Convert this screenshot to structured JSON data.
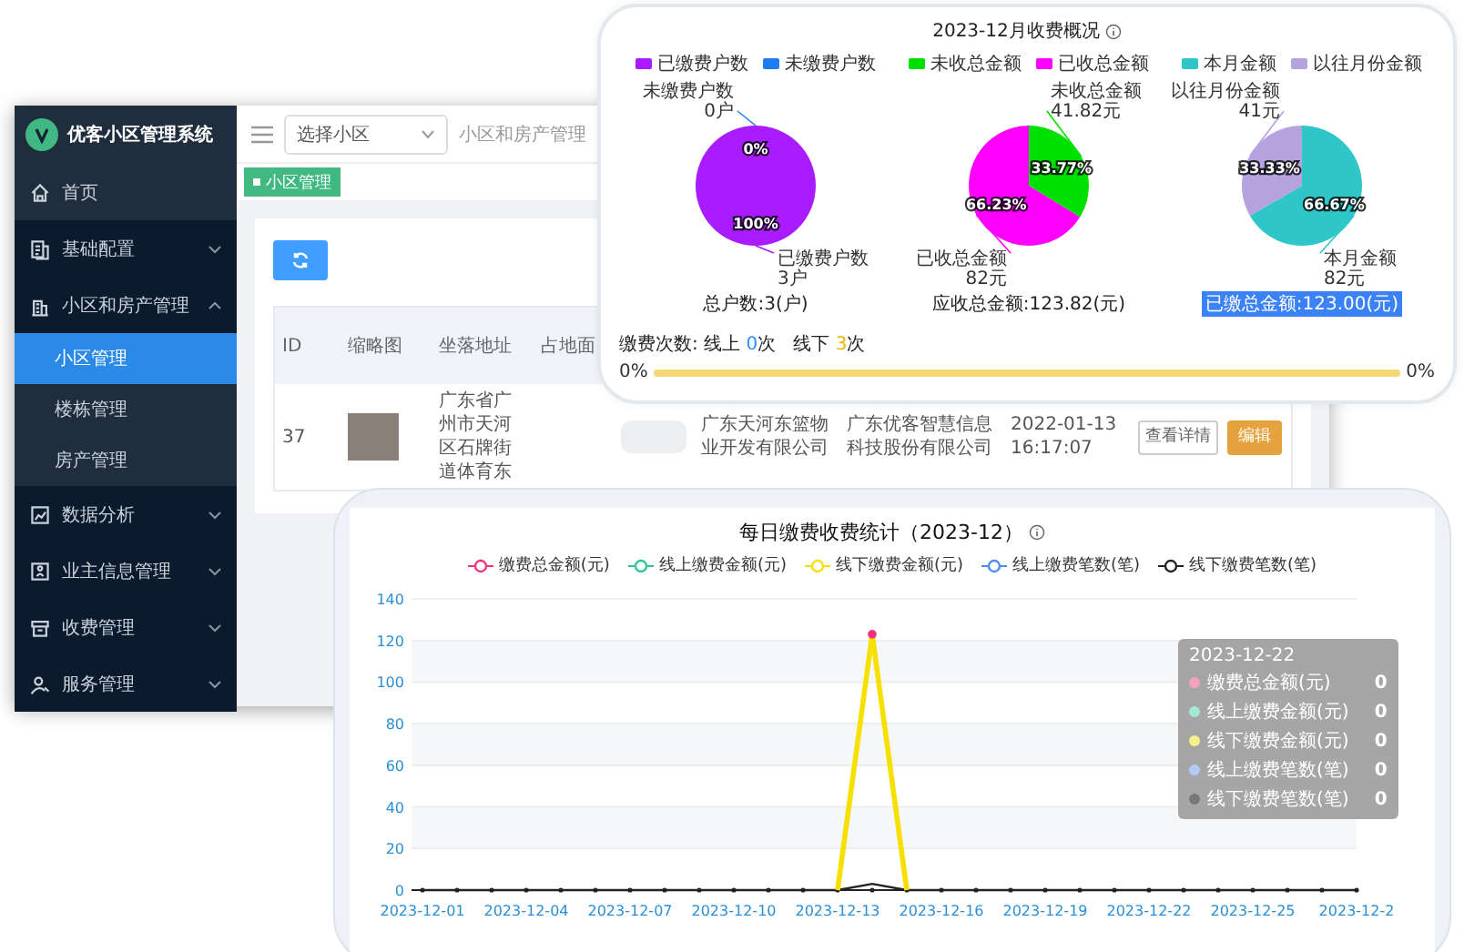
{
  "admin_window": {
    "logo_title": "优客小区管理系统",
    "sidebar": {
      "items": [
        {
          "label": "首页",
          "kind": "home",
          "highlighted": true
        },
        {
          "label": "基础配置",
          "kind": "document",
          "highlighted": false,
          "expanded": false
        },
        {
          "label": "小区和房产管理",
          "kind": "building",
          "highlighted": false,
          "expanded": true,
          "children": [
            {
              "label": "小区管理",
              "selected": true
            },
            {
              "label": "楼栋管理",
              "selected": false
            },
            {
              "label": "房产管理",
              "selected": false
            }
          ]
        },
        {
          "label": "数据分析",
          "kind": "chart",
          "highlighted": false,
          "expanded": false
        },
        {
          "label": "业主信息管理",
          "kind": "card",
          "highlighted": false,
          "expanded": false
        },
        {
          "label": "收费管理",
          "kind": "box",
          "highlighted": false,
          "expanded": false
        },
        {
          "label": "服务管理",
          "kind": "person",
          "highlighted": false,
          "expanded": false
        }
      ]
    },
    "topbar": {
      "select_value": "选择小区",
      "breadcrumb": "小区和房产管理"
    },
    "tag": "小区管理",
    "table": {
      "columns": [
        "ID",
        "缩略图",
        "坐落地址",
        "占地面"
      ],
      "rows": [
        {
          "id": "37",
          "address": "广东省广州市天河区石牌街道体育东",
          "company": "广东天河东篮物业开发有限公司",
          "developer": "广东优客智慧信息科技股份有限公司",
          "created": "2022-01-13 16:17:07",
          "actions": [
            "查看详情",
            "编辑"
          ]
        }
      ]
    }
  },
  "fee_overview": {
    "title": "2023-12月收费概况",
    "pies": [
      {
        "legend": [
          {
            "label": "已缴费户数",
            "color": "#a81cff"
          },
          {
            "label": "未缴费户数",
            "color": "#1e7cf0"
          }
        ],
        "chart_data": {
          "type": "pie",
          "categories": [
            "已缴费户数",
            "未缴费户数"
          ],
          "values": [
            100,
            0
          ],
          "value_labels": [
            "100%",
            "0%"
          ]
        },
        "callout_values": [
          "3户",
          "0户"
        ],
        "caption": "总户数:3(户)",
        "selected": false
      },
      {
        "legend": [
          {
            "label": "未收总金额",
            "color": "#00e000"
          },
          {
            "label": "已收总金额",
            "color": "#ff00ff"
          }
        ],
        "chart_data": {
          "type": "pie",
          "categories": [
            "未收总金额",
            "已收总金额"
          ],
          "values": [
            33.77,
            66.23
          ],
          "value_labels": [
            "33.77%",
            "66.23%"
          ]
        },
        "callout_values": [
          "41.82元",
          "82元"
        ],
        "caption": "应收总金额:123.82(元)",
        "selected": false
      },
      {
        "legend": [
          {
            "label": "本月金额",
            "color": "#2ec6c8"
          },
          {
            "label": "以往月份金额",
            "color": "#b6a2de"
          }
        ],
        "chart_data": {
          "type": "pie",
          "categories": [
            "本月金额",
            "以往月份金额"
          ],
          "values": [
            66.67,
            33.33
          ],
          "value_labels": [
            "66.67%",
            "33.33%"
          ]
        },
        "callout_values": [
          "82元",
          "41元"
        ],
        "caption": "已缴总金额:123.00(元)",
        "selected": true
      }
    ],
    "payment_counts": {
      "label": "缴费次数:",
      "online_label": "线上",
      "online_count": "0",
      "online_unit": "次",
      "offline_label": "线下",
      "offline_count": "3",
      "offline_unit": "次"
    },
    "ratio_bar": {
      "left_text": "0%",
      "right_text": "0%",
      "level": 1
    }
  },
  "daily_chart": {
    "title": "每日缴费收费统计（2023-12）",
    "chart_data": {
      "type": "line",
      "grid": true,
      "x": [
        "2023-12-01",
        "2023-12-02",
        "2023-12-03",
        "2023-12-04",
        "2023-12-05",
        "2023-12-06",
        "2023-12-07",
        "2023-12-08",
        "2023-12-09",
        "2023-12-10",
        "2023-12-11",
        "2023-12-12",
        "2023-12-13",
        "2023-12-14",
        "2023-12-15",
        "2023-12-16",
        "2023-12-17",
        "2023-12-18",
        "2023-12-19",
        "2023-12-20",
        "2023-12-21",
        "2023-12-22",
        "2023-12-23",
        "2023-12-24",
        "2023-12-25",
        "2023-12-26",
        "2023-12-27",
        "2023-12-28"
      ],
      "series": [
        {
          "name": "缴费总金额(元)",
          "color": "#f5317f",
          "marker": true,
          "values": [
            null,
            null,
            null,
            null,
            null,
            null,
            null,
            null,
            null,
            null,
            null,
            null,
            null,
            123,
            null,
            null,
            null,
            null,
            null,
            null,
            null,
            null,
            null,
            null,
            null,
            null,
            null,
            null
          ]
        },
        {
          "name": "线上缴费金额(元)",
          "color": "#2ec29b",
          "values": [
            null,
            null,
            null,
            null,
            null,
            null,
            null,
            null,
            null,
            null,
            null,
            null,
            null,
            null,
            null,
            null,
            null,
            null,
            null,
            null,
            null,
            null,
            null,
            null,
            null,
            null,
            null,
            null
          ]
        },
        {
          "name": "线下缴费金额(元)",
          "color": "#f5e000",
          "values": [
            null,
            null,
            null,
            null,
            null,
            null,
            null,
            null,
            null,
            null,
            null,
            null,
            0,
            123,
            0,
            null,
            null,
            null,
            null,
            null,
            null,
            null,
            null,
            null,
            null,
            null,
            null,
            null
          ]
        },
        {
          "name": "线上缴费笔数(笔)",
          "color": "#4a8cff",
          "values": [
            null,
            null,
            null,
            null,
            null,
            null,
            null,
            null,
            null,
            null,
            null,
            null,
            null,
            null,
            null,
            null,
            null,
            null,
            null,
            null,
            null,
            null,
            null,
            null,
            null,
            null,
            null,
            null
          ]
        },
        {
          "name": "线下缴费笔数(笔)",
          "color": "#222222",
          "values": [
            0,
            0,
            0,
            0,
            0,
            0,
            0,
            0,
            0,
            0,
            0,
            0,
            0,
            3,
            0,
            0,
            0,
            0,
            0,
            0,
            0,
            0,
            0,
            0,
            0,
            0,
            0,
            0
          ]
        }
      ],
      "xlim": [
        "2023-12-01",
        "2023-12-28"
      ],
      "ylim": [
        0,
        140
      ],
      "yticks": [
        0,
        20,
        40,
        60,
        80,
        100,
        120,
        140
      ],
      "xticks": [
        {
          "value": "2023-12-01",
          "label": "2023-12-01"
        },
        {
          "value": "2023-12-04",
          "label": "2023-12-04"
        },
        {
          "value": "2023-12-07",
          "label": "2023-12-07"
        },
        {
          "value": "2023-12-10",
          "label": "2023-12-10"
        },
        {
          "value": "2023-12-13",
          "label": "2023-12-13"
        },
        {
          "value": "2023-12-16",
          "label": "2023-12-16"
        },
        {
          "value": "2023-12-19",
          "label": "2023-12-19"
        },
        {
          "value": "2023-12-22",
          "label": "2023-12-22"
        },
        {
          "value": "2023-12-25",
          "label": "2023-12-25"
        },
        {
          "value": "2023-12-28",
          "label": "2023-12-2"
        }
      ]
    },
    "tooltip": {
      "title": "2023-12-22",
      "rows": [
        {
          "label": "缴费总金额(元)",
          "value": "0",
          "color": "#f7a1be"
        },
        {
          "label": "线上缴费金额(元)",
          "value": "0",
          "color": "#a6e6d5"
        },
        {
          "label": "线下缴费金额(元)",
          "value": "0",
          "color": "#f7f08a"
        },
        {
          "label": "线上缴费笔数(笔)",
          "value": "0",
          "color": "#b3ccf5"
        },
        {
          "label": "线下缴费笔数(笔)",
          "value": "0",
          "color": "#777777"
        }
      ]
    }
  }
}
